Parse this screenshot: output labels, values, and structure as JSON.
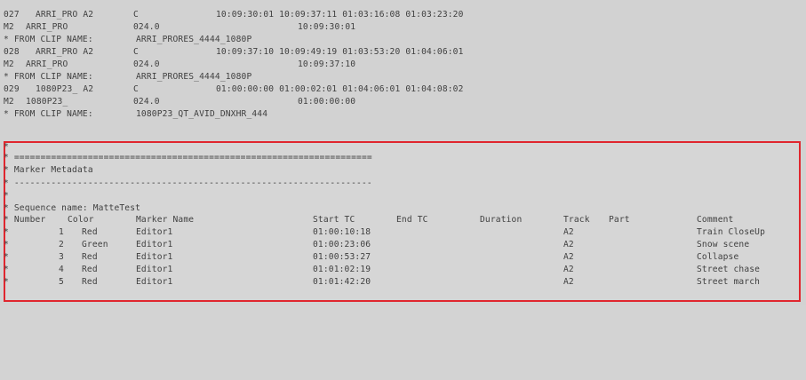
{
  "edl": {
    "lines": [
      {
        "cols": [
          "027",
          "ARRI_PRO A2",
          "C",
          "10:09:30:01 10:09:37:11 01:03:16:08 01:03:23:20"
        ]
      },
      {
        "cols": [
          "M2",
          "ARRI_PRO",
          "024.0",
          "10:09:30:01"
        ]
      },
      {
        "cols": [
          "* FROM CLIP NAME:",
          "ARRI_PRORES_4444_1080P"
        ]
      },
      {
        "cols": [
          "028",
          "ARRI_PRO A2",
          "C",
          "10:09:37:10 10:09:49:19 01:03:53:20 01:04:06:01"
        ]
      },
      {
        "cols": [
          "M2",
          "ARRI_PRO",
          "024.0",
          "10:09:37:10"
        ]
      },
      {
        "cols": [
          "* FROM CLIP NAME:",
          "ARRI_PRORES_4444_1080P"
        ]
      },
      {
        "cols": [
          "029",
          "1080P23_ A2",
          "C",
          "01:00:00:00 01:00:02:01 01:04:06:01 01:04:08:02"
        ]
      },
      {
        "cols": [
          "M2",
          "1080P23_",
          "024.0",
          "01:00:00:00"
        ]
      },
      {
        "cols": [
          "* FROM CLIP NAME:",
          "1080P23_QT_AVID_DNXHR_444"
        ]
      }
    ]
  },
  "marker_metadata": {
    "star": "*",
    "rule_equals": "* ====================================================================",
    "title": "* Marker Metadata",
    "rule_dashes": "* --------------------------------------------------------------------",
    "sequence_line": "* Sequence name: MatteTest",
    "headers": {
      "number": "* Number",
      "color": "Color",
      "marker_name": "Marker Name",
      "start_tc": "Start TC",
      "end_tc": "End TC",
      "duration": "Duration",
      "track": "Track",
      "part": "Part",
      "comment": "Comment"
    },
    "rows": [
      {
        "prefix": "*",
        "number": "1",
        "color": "Red",
        "marker_name": "Editor1",
        "start_tc": "01:00:10:18",
        "track": "A2",
        "comment": "Train CloseUp"
      },
      {
        "prefix": "*",
        "number": "2",
        "color": "Green",
        "marker_name": "Editor1",
        "start_tc": "01:00:23:06",
        "track": "A2",
        "comment": "Snow scene"
      },
      {
        "prefix": "*",
        "number": "3",
        "color": "Red",
        "marker_name": "Editor1",
        "start_tc": "01:00:53:27",
        "track": "A2",
        "comment": "Collapse"
      },
      {
        "prefix": "*",
        "number": "4",
        "color": "Red",
        "marker_name": "Editor1",
        "start_tc": "01:01:02:19",
        "track": "A2",
        "comment": "Street chase"
      },
      {
        "prefix": "*",
        "number": "5",
        "color": "Red",
        "marker_name": "Editor1",
        "start_tc": "01:01:42:20",
        "track": "A2",
        "comment": "Street march"
      }
    ]
  },
  "colors": {
    "background": "#d2d2d2",
    "text": "#404040",
    "highlight_border": "#e0262e"
  }
}
